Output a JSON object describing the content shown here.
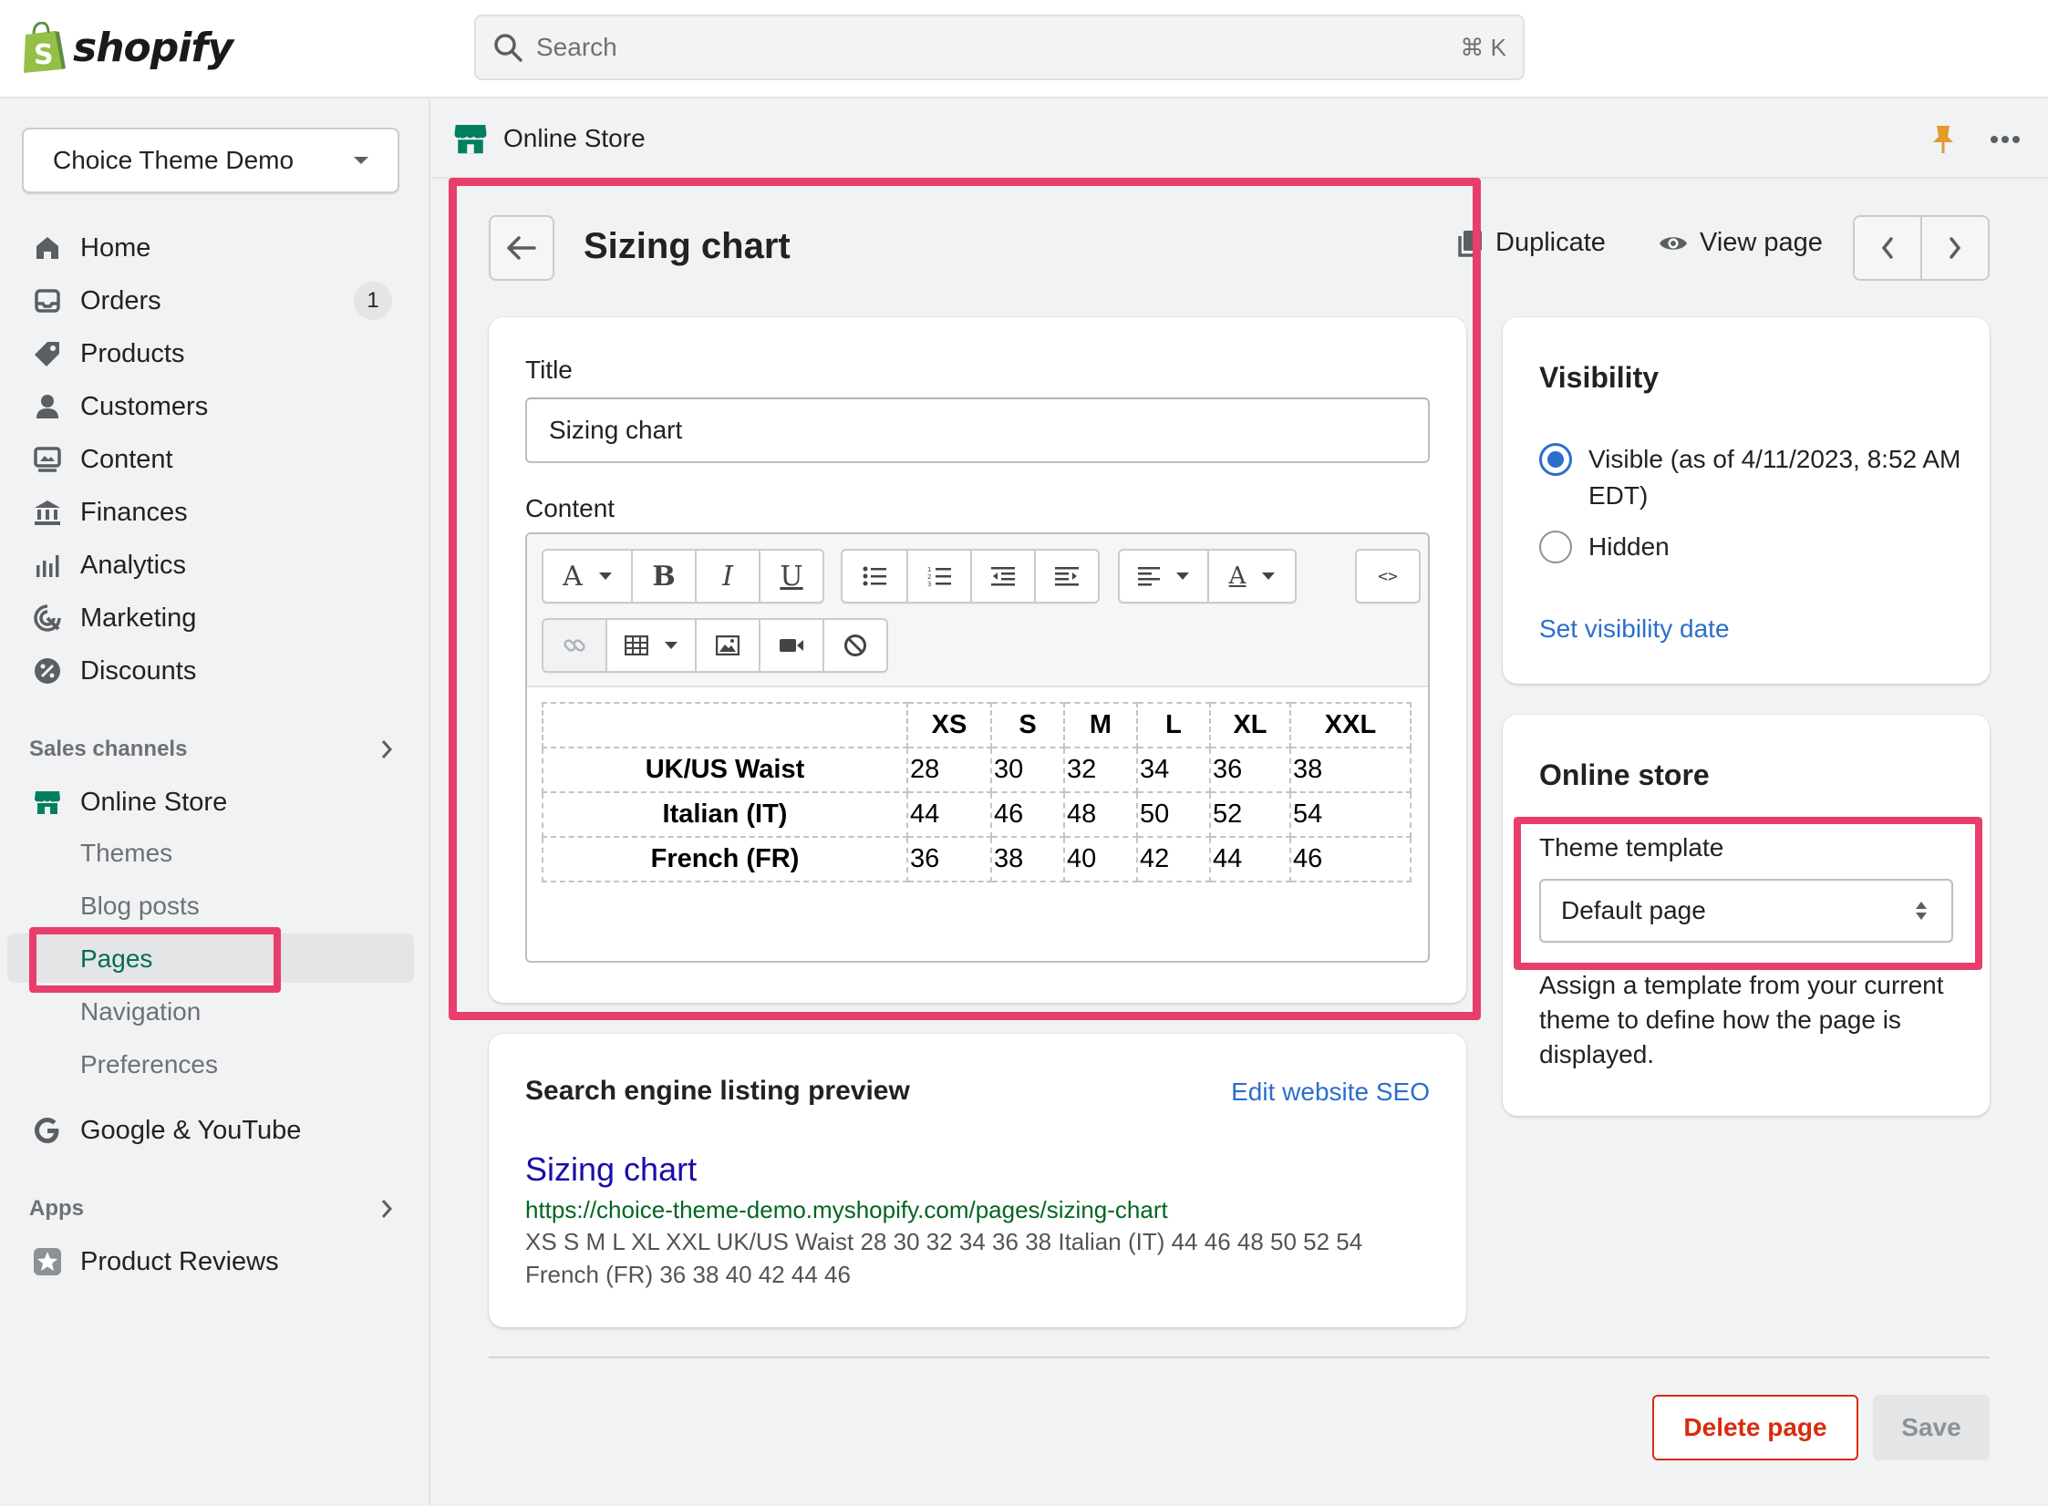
{
  "app": {
    "logo_text": "shopify",
    "search_placeholder": "Search",
    "search_shortcut": "⌘ K"
  },
  "sidebar": {
    "store_name": "Choice Theme Demo",
    "items": [
      {
        "label": "Home",
        "icon": "home-icon"
      },
      {
        "label": "Orders",
        "icon": "orders-icon",
        "badge": "1"
      },
      {
        "label": "Products",
        "icon": "tag-icon"
      },
      {
        "label": "Customers",
        "icon": "person-icon"
      },
      {
        "label": "Content",
        "icon": "content-icon"
      },
      {
        "label": "Finances",
        "icon": "bank-icon"
      },
      {
        "label": "Analytics",
        "icon": "bar-chart-icon"
      },
      {
        "label": "Marketing",
        "icon": "target-icon"
      },
      {
        "label": "Discounts",
        "icon": "discount-icon"
      }
    ],
    "sales_channels_label": "Sales channels",
    "online_store_label": "Online Store",
    "online_store_sub": [
      "Themes",
      "Blog posts",
      "Pages",
      "Navigation",
      "Preferences"
    ],
    "google_label": "Google & YouTube",
    "apps_label": "Apps",
    "product_reviews_label": "Product Reviews"
  },
  "header": {
    "title": "Online Store"
  },
  "page": {
    "title": "Sizing chart",
    "duplicate_label": "Duplicate",
    "view_page_label": "View page"
  },
  "editor": {
    "title_label": "Title",
    "title_value": "Sizing chart",
    "content_label": "Content",
    "table": {
      "headers": [
        "",
        "XS",
        "S",
        "M",
        "L",
        "XL",
        "XXL"
      ],
      "rows": [
        [
          "UK/US Waist",
          "28",
          "30",
          "32",
          "34",
          "36",
          "38"
        ],
        [
          "Italian (IT)",
          "44",
          "46",
          "48",
          "50",
          "52",
          "54"
        ],
        [
          "French (FR)",
          "36",
          "38",
          "40",
          "42",
          "44",
          "46"
        ]
      ]
    }
  },
  "seo": {
    "heading": "Search engine listing preview",
    "edit_label": "Edit website SEO",
    "link_title": "Sizing chart",
    "url": "https://choice-theme-demo.myshopify.com/pages/sizing-chart",
    "description": "XS S M L XL XXL UK/US Waist 28 30 32 34 36 38 Italian (IT) 44 46 48 50 52 54 French (FR) 36 38 40 42 44 46"
  },
  "visibility": {
    "heading": "Visibility",
    "visible_label": "Visible (as of 4/11/2023, 8:52 AM EDT)",
    "hidden_label": "Hidden",
    "set_date_label": "Set visibility date",
    "selected": "visible"
  },
  "online_store_card": {
    "heading": "Online store",
    "template_label": "Theme template",
    "template_value": "Default page",
    "help_text": "Assign a template from your current theme to define how the page is displayed."
  },
  "footer": {
    "delete_label": "Delete page",
    "save_label": "Save"
  },
  "colors": {
    "highlight": "#e83e6c",
    "link": "#2c6ecb",
    "brand_green": "#008060",
    "danger": "#d82c0d"
  }
}
